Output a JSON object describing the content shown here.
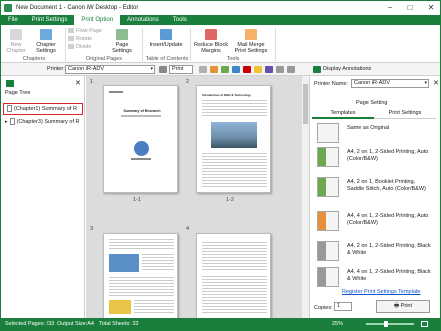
{
  "window": {
    "title": "New Document 1 - Canon iW Desktop - Editor",
    "controls": [
      "−",
      "□",
      "✕"
    ]
  },
  "menu_tabs": [
    "File",
    "Print Settings",
    "Print Option",
    "Annotations",
    "Tools"
  ],
  "active_tab_index": 2,
  "ribbon": {
    "new_chapter": "New Chapter",
    "chapter_settings": "Chapter Settings",
    "flow_page": "Flow Page",
    "rotate": "Rotate",
    "divide": "Divide",
    "page_settings": "Page Settings",
    "insert_update": "Insert/Update",
    "reduce_block_margins": "Reduce Block Margins",
    "mail_merge": "Mail Merge Print Settings",
    "groups": [
      "Chapters",
      "Original Pages",
      "Table of Contents",
      "Tools"
    ]
  },
  "printer_bar": {
    "label": "Printer:",
    "value": "Canon iR-ADV",
    "print_label": "Print",
    "display_annotations": "Display Annotations"
  },
  "page_tree": {
    "title": "Page Tree",
    "items": [
      "(Chapter1) Summary of R",
      "(Chapter3) Summary of R"
    ]
  },
  "pages": {
    "labels": [
      "1",
      "2",
      "3",
      "4"
    ],
    "captions": [
      "1-1",
      "1-2"
    ],
    "p1_title": "Summary of Research",
    "p2_title": "Introduction of R&D & Technology"
  },
  "right_panel": {
    "printer_label": "Printer Name:",
    "printer_value": "Canon iR-ADV",
    "page_setting": "Page Setting",
    "tabs": [
      "Templates",
      "Print Settings"
    ],
    "settings": [
      "Same as Original",
      "A4, 2 on 1, 2-Sided Printing, Auto (Color/B&W)",
      "A4, 2 on 1, Booklet Printing, Saddle Stitch, Auto (Color/B&W)",
      "A4, 4 on 1, 2-Sided Printing, Auto (Color/B&W)",
      "A4, 2 on 1, 2-Sided Printing, Black & White",
      "A4, 4 on 1, 2-Sided Printing, Black & White"
    ],
    "register_link": "Register Print Settings Template",
    "copies_label": "Copies:",
    "copies_value": "1",
    "print_button": "Print"
  },
  "status": {
    "selected": "Selected Pages: /33",
    "output": "Output Size:A4",
    "total": "Total Sheets: 33",
    "zoom": "25%"
  },
  "colors": {
    "brand": "#1a7f3c",
    "highlight_border": "#d9262c"
  }
}
